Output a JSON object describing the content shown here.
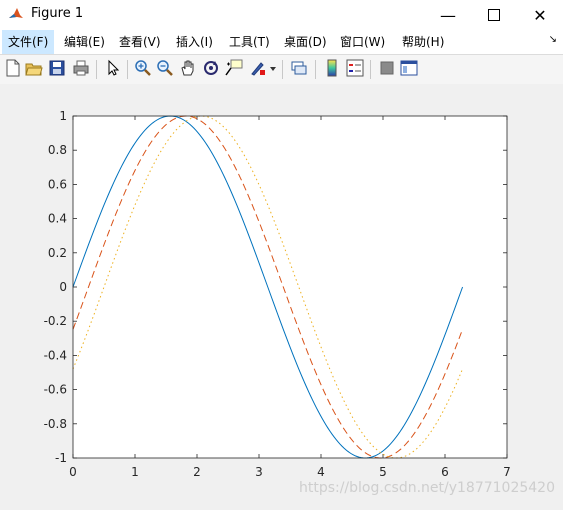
{
  "window": {
    "title": "Figure 1"
  },
  "menu": [
    "文件(F)",
    "编辑(E)",
    "查看(V)",
    "插入(I)",
    "工具(T)",
    "桌面(D)",
    "窗口(W)",
    "帮助(H)"
  ],
  "toolbar_icons": [
    "new-figure-icon",
    "open-file-icon",
    "save-icon",
    "print-icon",
    "pointer-icon",
    "zoom-in-icon",
    "zoom-out-icon",
    "pan-icon",
    "rotate-3d-icon",
    "data-cursor-icon",
    "brush-icon",
    "brush-dropdown-icon",
    "link-plot-icon",
    "colorbar-icon",
    "legend-icon",
    "hide-plot-tools-icon",
    "show-plot-tools-icon"
  ],
  "watermark": "https://blog.csdn.net/y18771025420",
  "chart_data": {
    "type": "line",
    "xlim": [
      0,
      7
    ],
    "ylim": [
      -1,
      1
    ],
    "xticks": [
      0,
      1,
      2,
      3,
      4,
      5,
      6,
      7
    ],
    "yticks": [
      -1,
      -0.8,
      -0.6,
      -0.4,
      -0.2,
      0,
      0.2,
      0.4,
      0.6,
      0.8,
      1
    ],
    "xtick_labels": [
      "0",
      "1",
      "2",
      "3",
      "4",
      "5",
      "6",
      "7"
    ],
    "ytick_labels": [
      "-1",
      "-0.8",
      "-0.6",
      "-0.4",
      "-0.2",
      "0",
      "0.2",
      "0.4",
      "0.6",
      "0.8",
      "1"
    ],
    "grid": false,
    "series": [
      {
        "function": "sin(x)",
        "phase": 0,
        "x_range": [
          0,
          6.2832
        ],
        "style": "solid",
        "color": "#0072bd"
      },
      {
        "function": "sin(x - 0.25)",
        "phase": 0.25,
        "x_range": [
          0,
          6.2832
        ],
        "style": "dashed",
        "color": "#d95319"
      },
      {
        "function": "sin(x - 0.5)",
        "phase": 0.5,
        "x_range": [
          0,
          6.2832
        ],
        "style": "dotted",
        "color": "#edb120"
      }
    ]
  }
}
